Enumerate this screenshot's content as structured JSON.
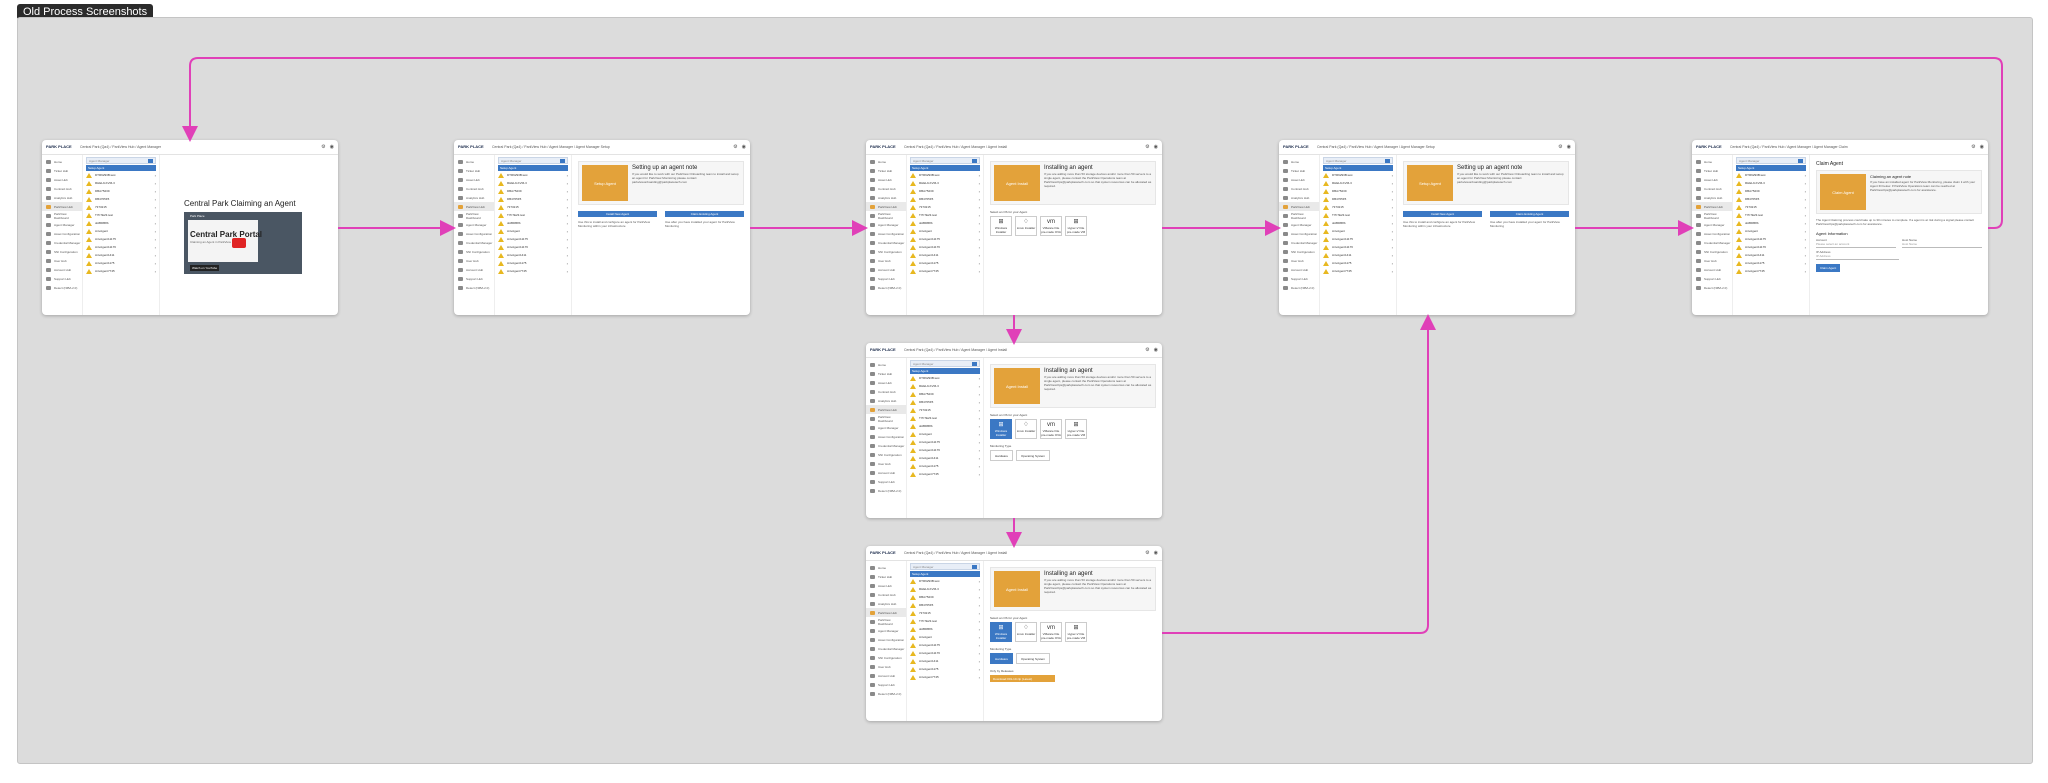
{
  "board": {
    "label": "Old Process Screenshots"
  },
  "logo": "PARK PLACE",
  "breadcrumbs": {
    "s1": "Central Park (Qa4) / ParkView Hub / Agent Manager",
    "s2": "Central Park (Qa4) / ParkView Hub / Agent Manager / Agent Manager Setup",
    "s3": "Central Park (Qa4) / ParkView Hub / Agent Manager / Agent Install",
    "s4": "Central Park (Qa4) / ParkView Hub / Agent Manager / Agent Manager Setup",
    "s5": "Central Park (Qa4) / ParkView Hub / Agent Manager / Agent Manager Claim",
    "s6": "Central Park (Qa4) / ParkView Hub / Agent Manager / Agent Install",
    "s7": "Central Park (Qa4) / ParkView Hub / Agent Manager / Agent Install"
  },
  "nav_items": [
    "Home",
    "Ticket Hub",
    "Asset Hub",
    "Contract Hub",
    "Analytics Hub",
    "ParkView Hub",
    "ParkView Dashboard",
    "Agent Manager",
    "Asset Configuration",
    "Credential Manager",
    "SNI Configuration",
    "User Hub",
    "Account Hub",
    "Support Hub",
    "Detect (NIBA 2.0)"
  ],
  "list": {
    "search_placeholder": "Agent Manager",
    "header": "Setup Agent",
    "rows": [
      "DTR9293B.test",
      "RHEL9-KVM-3",
      "DBA75239",
      "DB4705F5",
      "7373215",
      "T7F7E23.test",
      "dolBDB8b",
      "AnvAgent",
      "AnvAgent11175",
      "AnvAgent11176",
      "AnvAgent1411",
      "AnvAgent1175",
      "AnvAgent7745"
    ]
  },
  "s1": {
    "heading": "Central Park Claiming an Agent",
    "video": {
      "channel": "Park Place",
      "title": "Central Park Portal",
      "subtitle": "Claiming an Agent in ParkView Hub",
      "watch": "Watch on YouTube"
    }
  },
  "setup": {
    "badge": "Setup Agent",
    "title": "Setting up an agent note",
    "desc": "If you would like to work with our ParkView Onboarding team to install and setup an agent for ParkView Monitoring please contact parkviewonboarding@parkplacetech.com",
    "install_btn": "Install New Agent",
    "install_desc": "Use this to install and configure an agent for ParkView Monitoring within your infrastructure",
    "claim_btn": "Claim Existing Agent",
    "claim_desc": "Use after you have installed your agent for ParkView Monitoring"
  },
  "install": {
    "badge": "Agent Install",
    "title": "Installing an agent",
    "desc": "If you are adding more than 50 storage devices and/or more than 50 servers to a single agent, please contact the ParkView Operations team at ParkViewOps@parkplacetech.com so that system resources can be allocated as required.",
    "os_label": "Select an OS for your Agent",
    "os": [
      {
        "glyph": "⊞",
        "label": "Windows Installer"
      },
      {
        "glyph": "♢",
        "label": "Linux Installer"
      },
      {
        "glyph": "vm",
        "label": "VMware File pre-made OVA"
      },
      {
        "glyph": "⊞",
        "label": "Hyper-V File pre-made VM"
      }
    ],
    "monitoring_label": "Monitoring Type",
    "monitoring": [
      "Hardware",
      "Operating System"
    ],
    "release_label": "Only by Releases",
    "download_btn": "Download 001-10.zip (Latest)"
  },
  "claim": {
    "title": "Claim Agent",
    "badge": "Claim Agent",
    "note_title": "Claiming an agent note",
    "note": "If you have an installed agent for ParkView Monitoring, please claim it with your Agent ID below. If ParkView Operations team can be reached at ParkViewOps@parkplacetech.com for assistance.",
    "info": "The Agent Claiming process could take up to 30 minutes to complete. If a agent is at risk during a signal please contact ParkViewOps@parkplacetech.com for assistance.",
    "section": "Agent Information",
    "account_label": "Account",
    "account_ph": "Please select an account",
    "host_label": "Host Name",
    "host_ph": "Host Name",
    "ip_label": "IP Address",
    "ip_ph": "IP Address",
    "btn": "Claim Agent"
  },
  "colors": {
    "accent": "#3b78c4",
    "agent_orange": "#e3a23a",
    "flow_arrow": "#e040b8",
    "board_bg": "#dcdcdc"
  }
}
